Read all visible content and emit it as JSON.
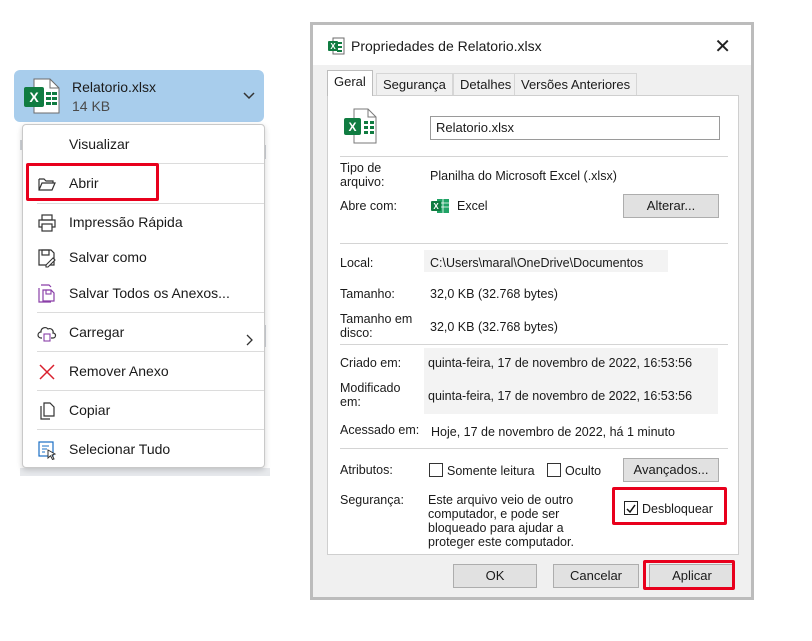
{
  "attachment": {
    "filename": "Relatorio.xlsx",
    "size": "14 KB"
  },
  "context_menu": {
    "items": [
      {
        "label": "Visualizar",
        "icon": "none"
      },
      {
        "label": "Abrir",
        "icon": "folder-open-icon"
      },
      {
        "label": "Impressão Rápida",
        "icon": "printer-icon"
      },
      {
        "label": "Salvar como",
        "icon": "save-as-icon"
      },
      {
        "label": "Salvar Todos os Anexos...",
        "icon": "save-all-icon"
      },
      {
        "label": "Carregar",
        "icon": "cloud-upload-icon"
      },
      {
        "label": "Remover Anexo",
        "icon": "close-icon"
      },
      {
        "label": "Copiar",
        "icon": "copy-icon"
      },
      {
        "label": "Selecionar Tudo",
        "icon": "select-all-icon"
      }
    ]
  },
  "dialog": {
    "title": "Propriedades de Relatorio.xlsx",
    "tabs": [
      "Geral",
      "Segurança",
      "Detalhes",
      "Versões Anteriores"
    ],
    "filename": "Relatorio.xlsx",
    "type_label": "Tipo de arquivo:",
    "type_value": "Planilha do Microsoft Excel (.xlsx)",
    "opens_with_label": "Abre com:",
    "opens_with_value": "Excel",
    "change_button": "Alterar...",
    "location_label": "Local:",
    "location_value": "C:\\Users\\maral\\OneDrive\\Documentos",
    "size_label": "Tamanho:",
    "size_value": "32,0 KB (32.768 bytes)",
    "disk_size_label": "Tamanho em disco:",
    "disk_size_value": "32,0 KB (32.768 bytes)",
    "created_label": "Criado em:",
    "created_value": "quinta-feira, 17 de novembro de 2022, 16:53:56",
    "modified_label": "Modificado em:",
    "modified_value": "quinta-feira, 17 de novembro de 2022, 16:53:56",
    "accessed_label": "Acessado em:",
    "accessed_value": "Hoje, 17 de novembro de 2022, há 1 minuto",
    "attributes_label": "Atributos:",
    "readonly_label": "Somente leitura",
    "hidden_label": "Oculto",
    "advanced_button": "Avançados...",
    "security_label": "Segurança:",
    "security_text": "Este arquivo veio de outro computador, e pode ser bloqueado para ajudar a proteger este computador.",
    "unblock_label": "Desbloquear",
    "unblock_checked": true,
    "ok_button": "OK",
    "cancel_button": "Cancelar",
    "apply_button": "Aplicar"
  },
  "colors": {
    "chip_bg": "#a8cdec",
    "highlight_red": "#e8001c",
    "excel_green": "#107c41"
  }
}
